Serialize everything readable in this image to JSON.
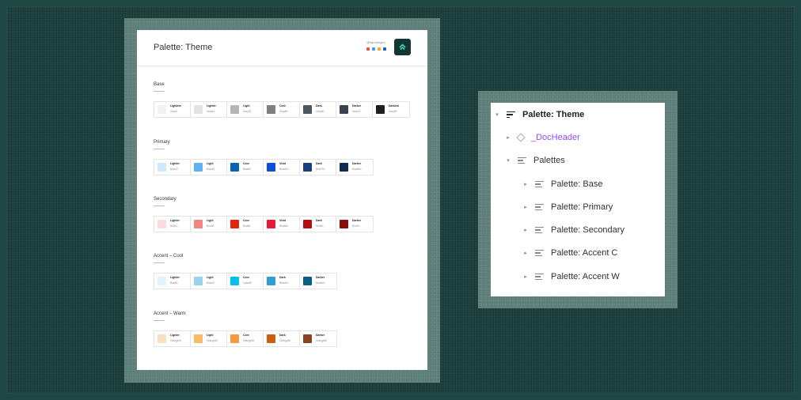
{
  "document": {
    "title": "Palette: Theme",
    "handle": "@figmatrigen",
    "sections": [
      {
        "title": "Base",
        "swatches": [
          {
            "name": "Lightest",
            "var": "Gray5",
            "color": "#f2f2f2"
          },
          {
            "name": "Lighter",
            "var": "Gray10",
            "color": "#e3e3e3"
          },
          {
            "name": "Light",
            "var": "Gray30",
            "color": "#b5b5b5"
          },
          {
            "name": "Core",
            "var": "Gray60",
            "color": "#808080"
          },
          {
            "name": "Dark",
            "var": "Gray80",
            "color": "#4c5560"
          },
          {
            "name": "Darker",
            "var": "Gray70",
            "color": "#3b4150"
          },
          {
            "name": "Darkest",
            "var": "Gray90",
            "color": "#1e1e1e"
          }
        ]
      },
      {
        "title": "Primary",
        "swatches": [
          {
            "name": "Lighter",
            "var": "Blue10",
            "color": "#cfe8ff"
          },
          {
            "name": "Light",
            "var": "Blue30",
            "color": "#5db1f5"
          },
          {
            "name": "Core",
            "var": "Blue50",
            "color": "#0b63b2"
          },
          {
            "name": "Vivid",
            "var": "Blue60v",
            "color": "#0b4fd6"
          },
          {
            "name": "Dark",
            "var": "Blue70v",
            "color": "#1b3f7c"
          },
          {
            "name": "Darker",
            "var": "Blue80v",
            "color": "#122a52"
          }
        ]
      },
      {
        "title": "Secondary",
        "swatches": [
          {
            "name": "Lighter",
            "var": "Red10",
            "color": "#fbdcdc"
          },
          {
            "name": "Light",
            "var": "Red30",
            "color": "#f0867d"
          },
          {
            "name": "Core",
            "var": "Red50",
            "color": "#e1260e"
          },
          {
            "name": "Vivid",
            "var": "Red50v",
            "color": "#e51d3a"
          },
          {
            "name": "Dark",
            "var": "Red60",
            "color": "#b01010"
          },
          {
            "name": "Darker",
            "var": "Red70",
            "color": "#8b0a0a"
          }
        ]
      },
      {
        "title": "Accent – Cool",
        "swatches": [
          {
            "name": "Lighter",
            "var": "Blue5v",
            "color": "#e1f3fb"
          },
          {
            "name": "Light",
            "var": "Blue20",
            "color": "#97d3ee"
          },
          {
            "name": "Core",
            "var": "Cyan30",
            "color": "#04c0ea"
          },
          {
            "name": "Dark",
            "var": "Blue40v",
            "color": "#2f9fd6"
          },
          {
            "name": "Darker",
            "var": "Blue60v",
            "color": "#0a5e86"
          }
        ]
      },
      {
        "title": "Accent – Warm",
        "swatches": [
          {
            "name": "Lighter",
            "var": "Orange10",
            "color": "#fadfc1"
          },
          {
            "name": "Light",
            "var": "Orange20",
            "color": "#f8b969"
          },
          {
            "name": "Core",
            "var": "Orange30",
            "color": "#f79a3c"
          },
          {
            "name": "Dark",
            "var": "Orange50",
            "color": "#cf5d0e"
          },
          {
            "name": "Darker",
            "var": "Orange60",
            "color": "#8a4321"
          }
        ]
      }
    ]
  },
  "layers": {
    "items": [
      {
        "label": "Palette: Theme",
        "caret": "▾",
        "icon": "frame-icon",
        "bold": true
      },
      {
        "label": "_DocHeader",
        "caret": "▸",
        "icon": "component-icon",
        "color": "#9747ff"
      },
      {
        "label": "Palettes",
        "caret": "▾",
        "icon": "frame-icon"
      },
      {
        "label": "Palette: Base",
        "caret": "▸",
        "icon": "frame-icon"
      },
      {
        "label": "Palette: Primary",
        "caret": "▸",
        "icon": "frame-icon"
      },
      {
        "label": "Palette: Secondary",
        "caret": "▸",
        "icon": "frame-icon"
      },
      {
        "label": "Palette: Accent C",
        "caret": "▸",
        "icon": "frame-icon"
      },
      {
        "label": "Palette: Accent W",
        "caret": "▸",
        "icon": "frame-icon"
      }
    ]
  },
  "colors": {
    "background": "#1c3f3b",
    "logo": "#123632",
    "logo_mark": "#3fd1b0",
    "socials": [
      "#e8553e",
      "#3b9cf0",
      "#f2a531",
      "#0a66c2"
    ]
  }
}
